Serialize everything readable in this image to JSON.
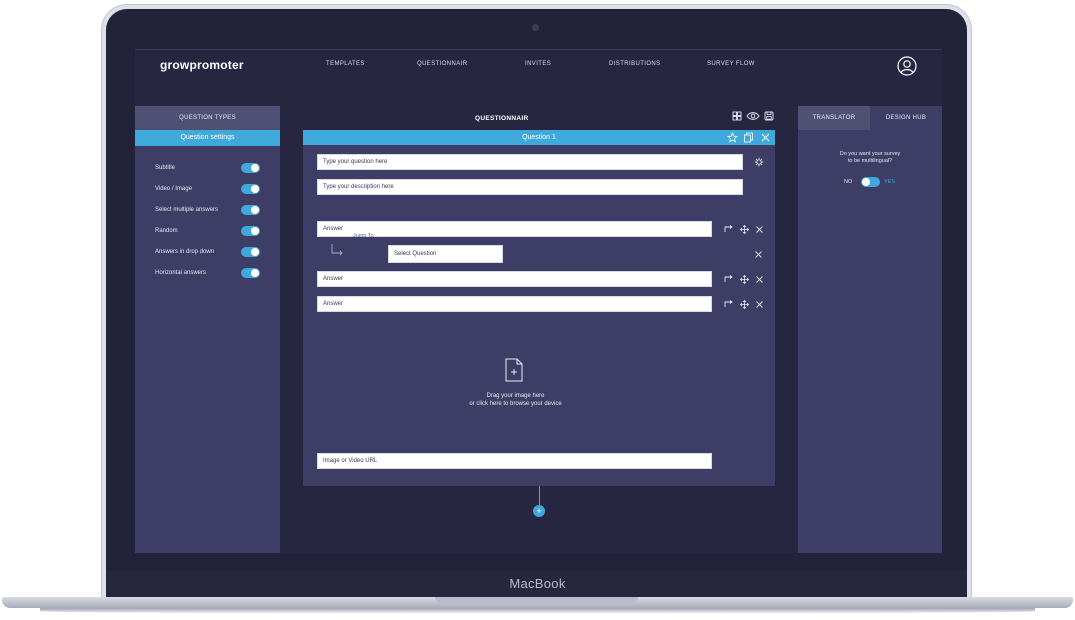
{
  "app": {
    "logo": "growpromoter"
  },
  "nav": {
    "items": [
      "TEMPLATES",
      "QUESTIONNAIR",
      "INVITES",
      "DISTRIBUTIONS",
      "SURVEY FLOW"
    ]
  },
  "left_panel": {
    "tab_label": "QUESTION TYPES",
    "settings_label": "Question settings",
    "settings": [
      {
        "label": "Subtitle",
        "on": true
      },
      {
        "label": "Video / Image",
        "on": true
      },
      {
        "label": "Select multiple answers",
        "on": true
      },
      {
        "label": "Random",
        "on": true
      },
      {
        "label": "Answers in drop down",
        "on": true
      },
      {
        "label": "Horizontal answers",
        "on": true
      }
    ]
  },
  "center": {
    "title": "QUESTIONNAIR",
    "card_title": "Question 1",
    "question_placeholder": "Type your question here",
    "description_placeholder": "Type your description here",
    "answers": [
      "Answer",
      "Answer",
      "Answer"
    ],
    "jump_to_label": "Jump To",
    "select_question": "Select Question",
    "drop_line1": "Drag your image here",
    "drop_line2": "or click here to browse your device",
    "url_placeholder": "Image or Video URL",
    "add_button": "+"
  },
  "right_panel": {
    "tabs": [
      "TRANSLATOR",
      "DESIGN HUB"
    ],
    "question_line1": "Do you want your survey",
    "question_line2": "to be multilingual?",
    "no_label": "NO",
    "yes_label": "YES"
  },
  "device": {
    "label": "MacBook"
  },
  "colors": {
    "accent": "#3fa9dc",
    "panel": "#3d3d65",
    "background": "#262641"
  }
}
